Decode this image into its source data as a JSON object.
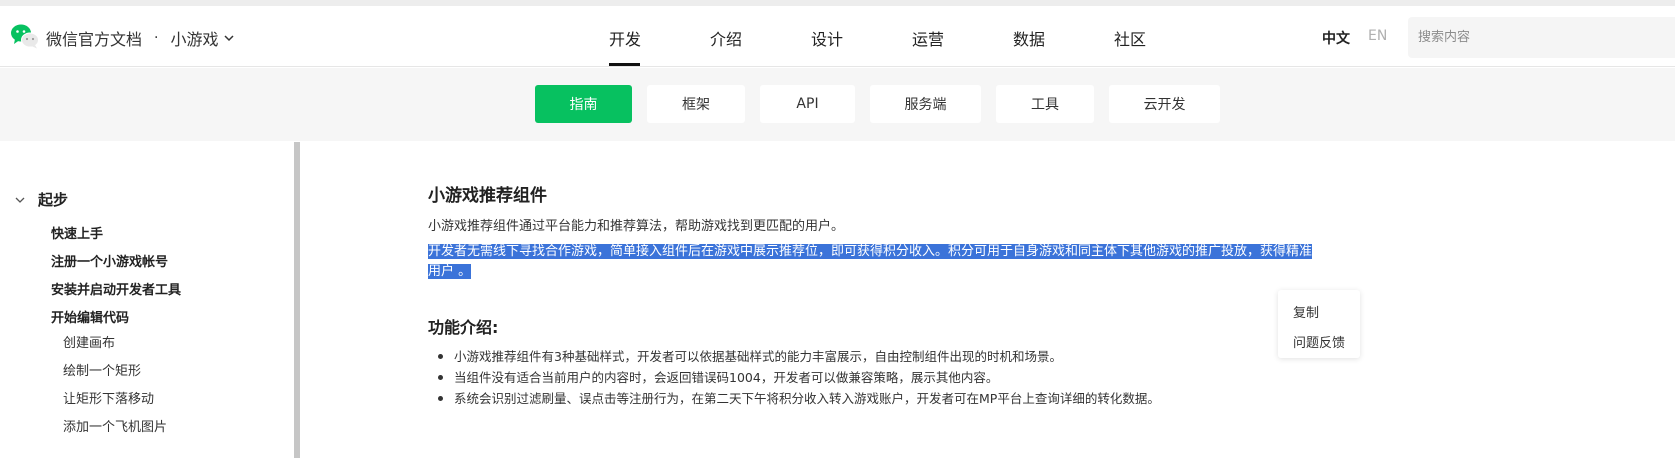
{
  "header": {
    "brand_title": "微信官方文档",
    "brand_separator": "·",
    "product": "小游戏",
    "nav": [
      {
        "label": "开发",
        "active": true
      },
      {
        "label": "介绍",
        "active": false
      },
      {
        "label": "设计",
        "active": false
      },
      {
        "label": "运营",
        "active": false
      },
      {
        "label": "数据",
        "active": false
      },
      {
        "label": "社区",
        "active": false
      }
    ],
    "lang_zh": "中文",
    "lang_en": "EN",
    "search_placeholder": "搜索内容"
  },
  "subnav": {
    "items": [
      {
        "label": "指南",
        "active": true
      },
      {
        "label": "框架",
        "active": false
      },
      {
        "label": "API",
        "active": false
      },
      {
        "label": "服务端",
        "active": false
      },
      {
        "label": "工具",
        "active": false
      },
      {
        "label": "云开发",
        "active": false
      }
    ]
  },
  "sidebar": {
    "group": "起步",
    "items": [
      {
        "label": "快速上手",
        "level": 1
      },
      {
        "label": "注册一个小游戏帐号",
        "level": 1
      },
      {
        "label": "安装并启动开发者工具",
        "level": 1
      },
      {
        "label": "开始编辑代码",
        "level": 1
      },
      {
        "label": "创建画布",
        "level": 2
      },
      {
        "label": "绘制一个矩形",
        "level": 2
      },
      {
        "label": "让矩形下落移动",
        "level": 2
      },
      {
        "label": "添加一个飞机图片",
        "level": 2
      }
    ]
  },
  "content": {
    "title": "小游戏推荐组件",
    "intro": "小游戏推荐组件通过平台能力和推荐算法，帮助游戏找到更匹配的用户。",
    "selected_line1": "开发者无需线下寻找合作游戏，简单接入组件后在游戏中展示推荐位，即可获得积分收入。积分可用于自身游戏和同主体下其他游戏的推广投放，获得精准",
    "selected_line2": "用户 。",
    "section_title": "功能介绍:",
    "bullets": [
      "小游戏推荐组件有3种基础样式，开发者可以依据基础样式的能力丰富展示，自由控制组件出现的时机和场景。",
      "当组件没有适合当前用户的内容时，会返回错误码1004，开发者可以做兼容策略，展示其他内容。",
      "系统会识别过滤刷量、误点击等注册行为，在第二天下午将积分收入转入游戏账户，开发者可在MP平台上查询详细的转化数据。"
    ]
  },
  "context_menu": {
    "items": [
      "复制",
      "问题反馈"
    ]
  },
  "colors": {
    "accent_green": "#07c160",
    "selection_blue": "#3b73d9"
  },
  "icons": {
    "logo": "wechat-logo-icon",
    "product_dropdown": "chevron-down-icon",
    "group_toggle": "chevron-down-icon"
  }
}
